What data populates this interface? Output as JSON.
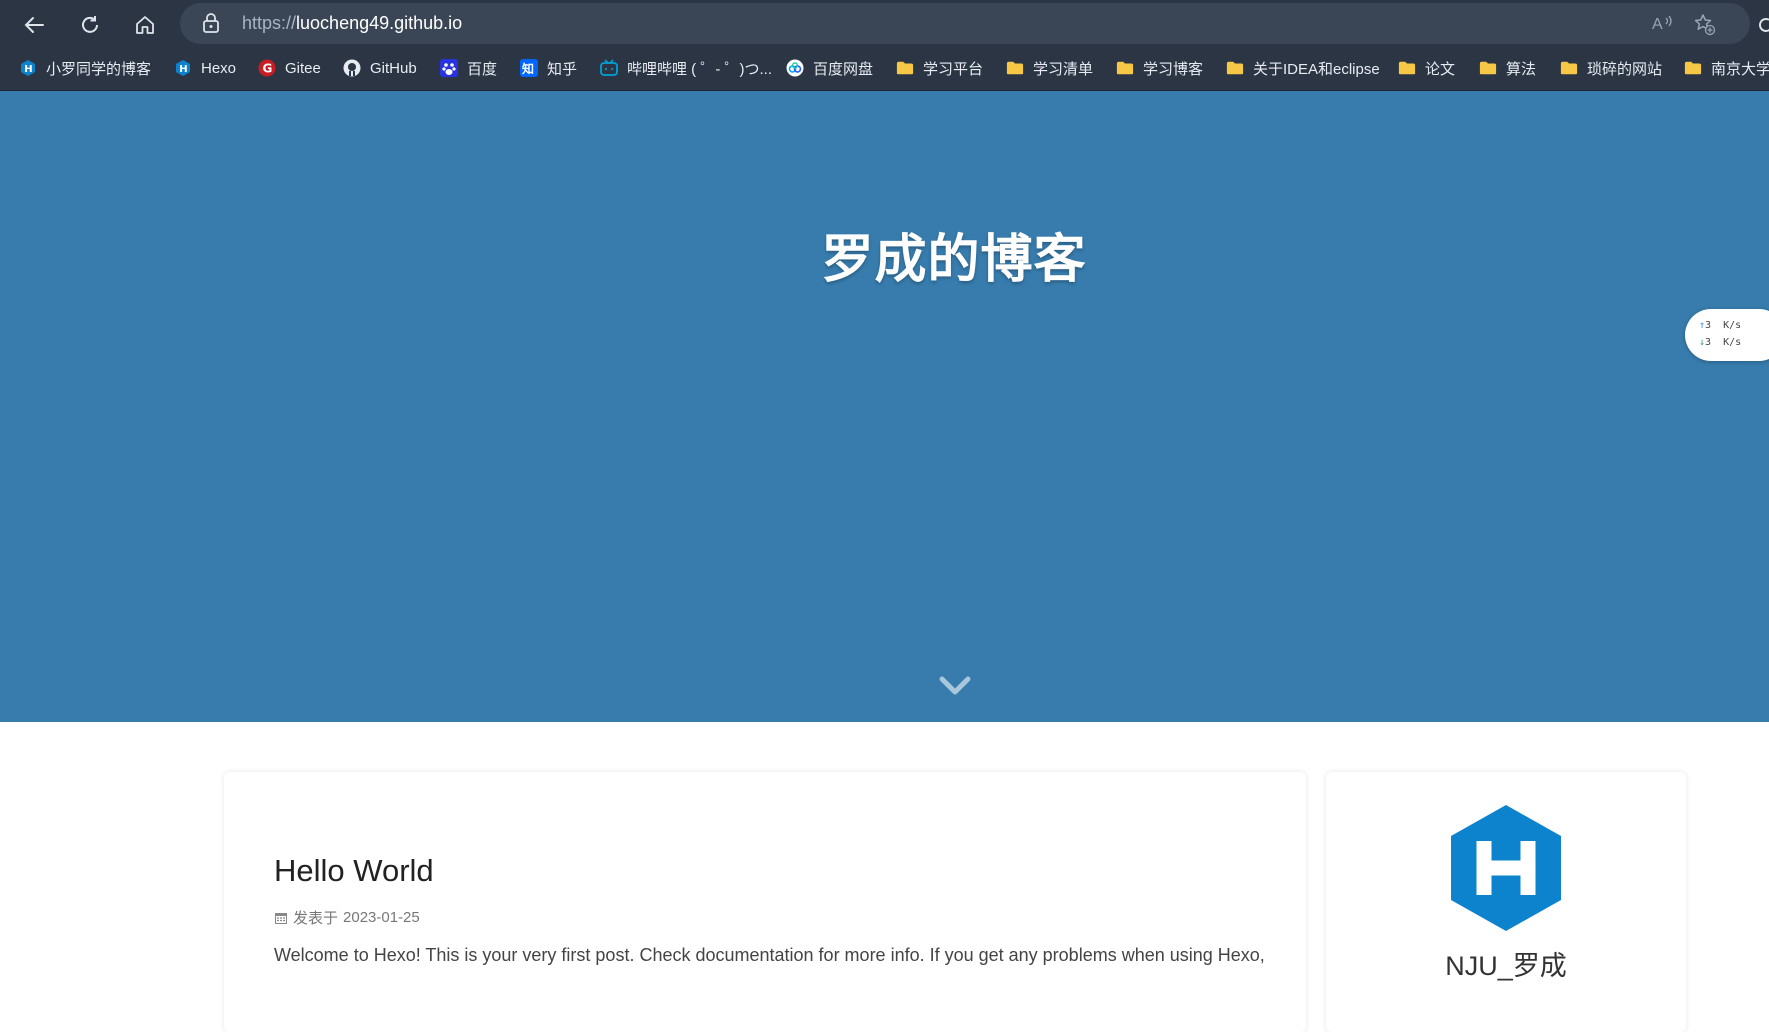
{
  "browser": {
    "url_protocol": "https://",
    "url_host": "luocheng49.github.io",
    "bookmarks": [
      {
        "label": "小罗同学的博客",
        "icon": "hexo-icon"
      },
      {
        "label": "Hexo",
        "icon": "hexo-icon"
      },
      {
        "label": "Gitee",
        "icon": "gitee-icon"
      },
      {
        "label": "GitHub",
        "icon": "github-icon"
      },
      {
        "label": "百度",
        "icon": "baidu-icon"
      },
      {
        "label": "知乎",
        "icon": "zhihu-icon"
      },
      {
        "label": "哔哩哔哩 ( ゜- ゜)つ...",
        "icon": "bilibili-icon"
      },
      {
        "label": "百度网盘",
        "icon": "baidu-netdisk-icon"
      },
      {
        "label": "学习平台",
        "icon": "folder-icon"
      },
      {
        "label": "学习清单",
        "icon": "folder-icon"
      },
      {
        "label": "学习博客",
        "icon": "folder-icon"
      },
      {
        "label": "关于IDEA和eclipse",
        "icon": "folder-icon"
      },
      {
        "label": "论文",
        "icon": "folder-icon"
      },
      {
        "label": "算法",
        "icon": "folder-icon"
      },
      {
        "label": "琐碎的网站",
        "icon": "folder-icon"
      },
      {
        "label": "南京大学",
        "icon": "folder-icon"
      }
    ]
  },
  "hero": {
    "title": "罗成的博客"
  },
  "speed_widget": {
    "up": "3",
    "down": "3",
    "unit": "K/s"
  },
  "post": {
    "title": "Hello World",
    "meta_prefix": "发表于",
    "date": "2023-01-25",
    "excerpt": "Welcome to Hexo! This is your very first post. Check documentation for more info. If you get any problems when using Hexo,"
  },
  "sidebar": {
    "author": "NJU_罗成"
  },
  "colors": {
    "hero_bg": "#377cad",
    "browser_chrome": "#2b3544",
    "hexo_blue": "#0e83cd"
  }
}
